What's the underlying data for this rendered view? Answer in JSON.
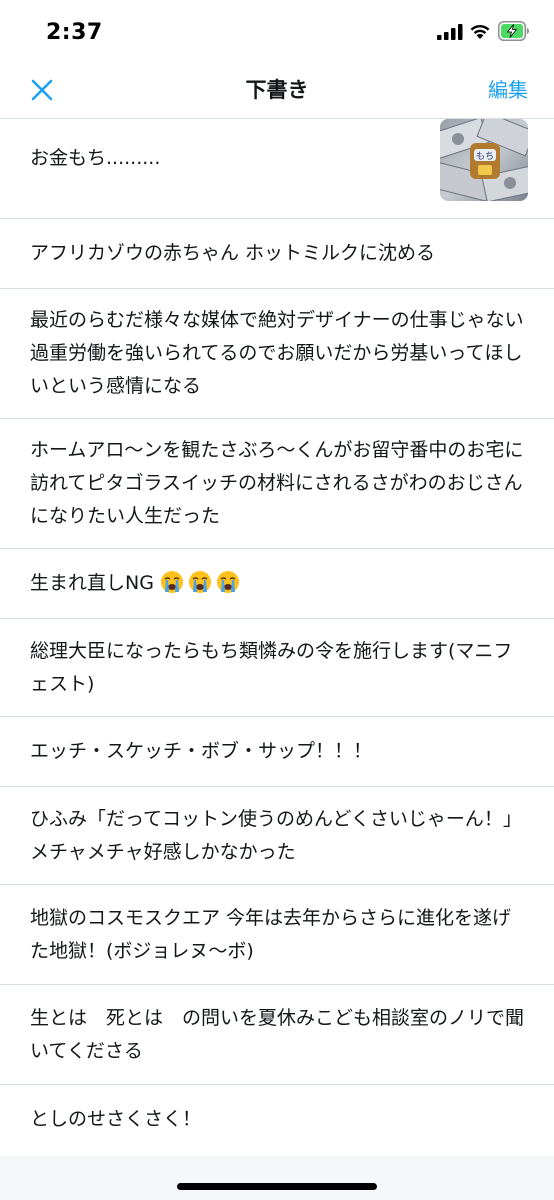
{
  "status_bar": {
    "time": "2:37"
  },
  "nav": {
    "title": "下書き",
    "edit_label": "編集",
    "close_icon": "close-icon",
    "accent_color": "#1da1f2"
  },
  "drafts": [
    {
      "text": "お金もち.........",
      "has_thumbnail": true
    },
    {
      "text": "アフリカゾウの赤ちゃん ホットミルクに沈める"
    },
    {
      "text": "最近のらむだ様々な媒体で絶対デザイナーの仕事じゃない過重労働を強いられてるのでお願いだから労基いってほしいという感情になる"
    },
    {
      "text": "ホームアロ〜ンを観たさぶろ〜くんがお留守番中のお宅に訪れてピタゴラスイッチの材料にされるさがわのおじさんになりたい人生だった"
    },
    {
      "text": "生まれ直しNG",
      "emoji": [
        "crying-face",
        "crying-face",
        "crying-face"
      ]
    },
    {
      "text": "総理大臣になったらもち類憐みの令を施行します(マニフェスト)"
    },
    {
      "text": "エッチ・スケッチ・ボブ・サップ！！！"
    },
    {
      "text": "ひふみ「だってコットン使うのめんどくさいじゃーん！」メチャメチャ好感しかなかった"
    },
    {
      "text": "地獄のコスモスクエア 今年は去年からさらに進化を遂げた地獄！(ボジョレヌ〜ボ)"
    },
    {
      "text": "生とは　死とは　の問いを夏休みこども相談室のノリで聞いてくださる"
    },
    {
      "text": "としのせさくさく！"
    }
  ]
}
